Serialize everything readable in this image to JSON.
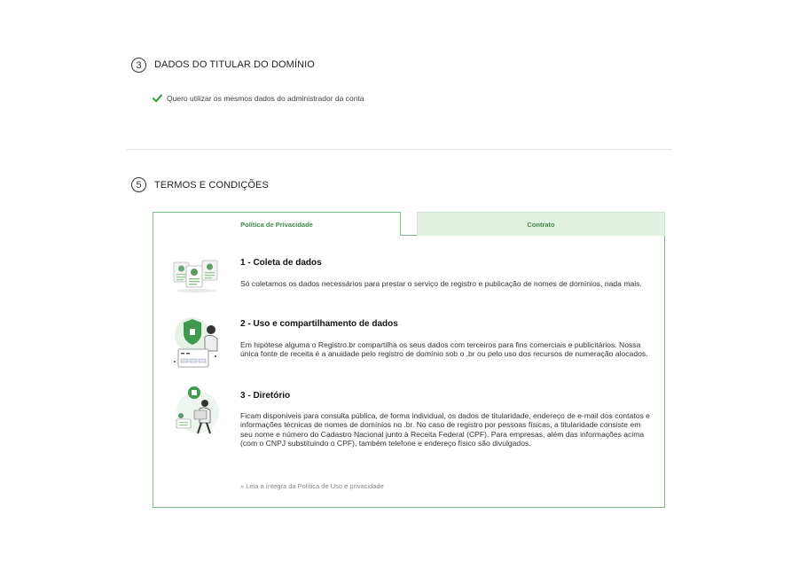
{
  "section3": {
    "number": "3",
    "title": "DADOS DO TITULAR DO DOMÍNIO",
    "checkbox_label": "Quero utilizar os mesmos dados do administrador da conta"
  },
  "section5": {
    "number": "5",
    "title": "TERMOS E CONDIÇÕES",
    "tabs": [
      {
        "label": "Política de Privacidade",
        "active": true
      },
      {
        "label": "Contrato",
        "active": false
      }
    ],
    "items": [
      {
        "icon": "profile-cards-illustration",
        "title": "1 - Coleta de dados",
        "text": "Só coletamos os dados necessários para prestar o serviço de registro e publicação de nomes de domínios, nada mais."
      },
      {
        "icon": "shield-sharing-illustration",
        "title": "2 - Uso e compartilhamento de dados",
        "text": "Em hipótese alguma o Registro.br compartilha os seus dados com terceiros para fins comerciais e publicitários. Nossa única fonte de receita é a anuidade pelo registro de domínio sob o .br ou pelo uso dos recursos de numeração alocados."
      },
      {
        "icon": "directory-person-illustration",
        "title": "3 - Diretório",
        "text": "Ficam disponíveis para consulta pública, de forma individual, os dados de titularidade, endereço de e-mail dos contatos e informações técnicas de nomes de domínios no .br. No caso de registro por pessoas físicas, a titularidade consiste em seu nome e número do Cadastro Nacional junto à Receita Federal (CPF). Para empresas, além das informações acima (com o CNPJ substituindo o CPF), também telefone e endereço físico são divulgados."
      }
    ],
    "read_more": "» Leia a íntegra da Política de Uso e privacidade"
  },
  "colors": {
    "accent_green": "#3c8a45",
    "border_green": "#7cbb86",
    "tab_inactive_bg": "#e3f1e3",
    "check_green": "#2e9a3e"
  }
}
